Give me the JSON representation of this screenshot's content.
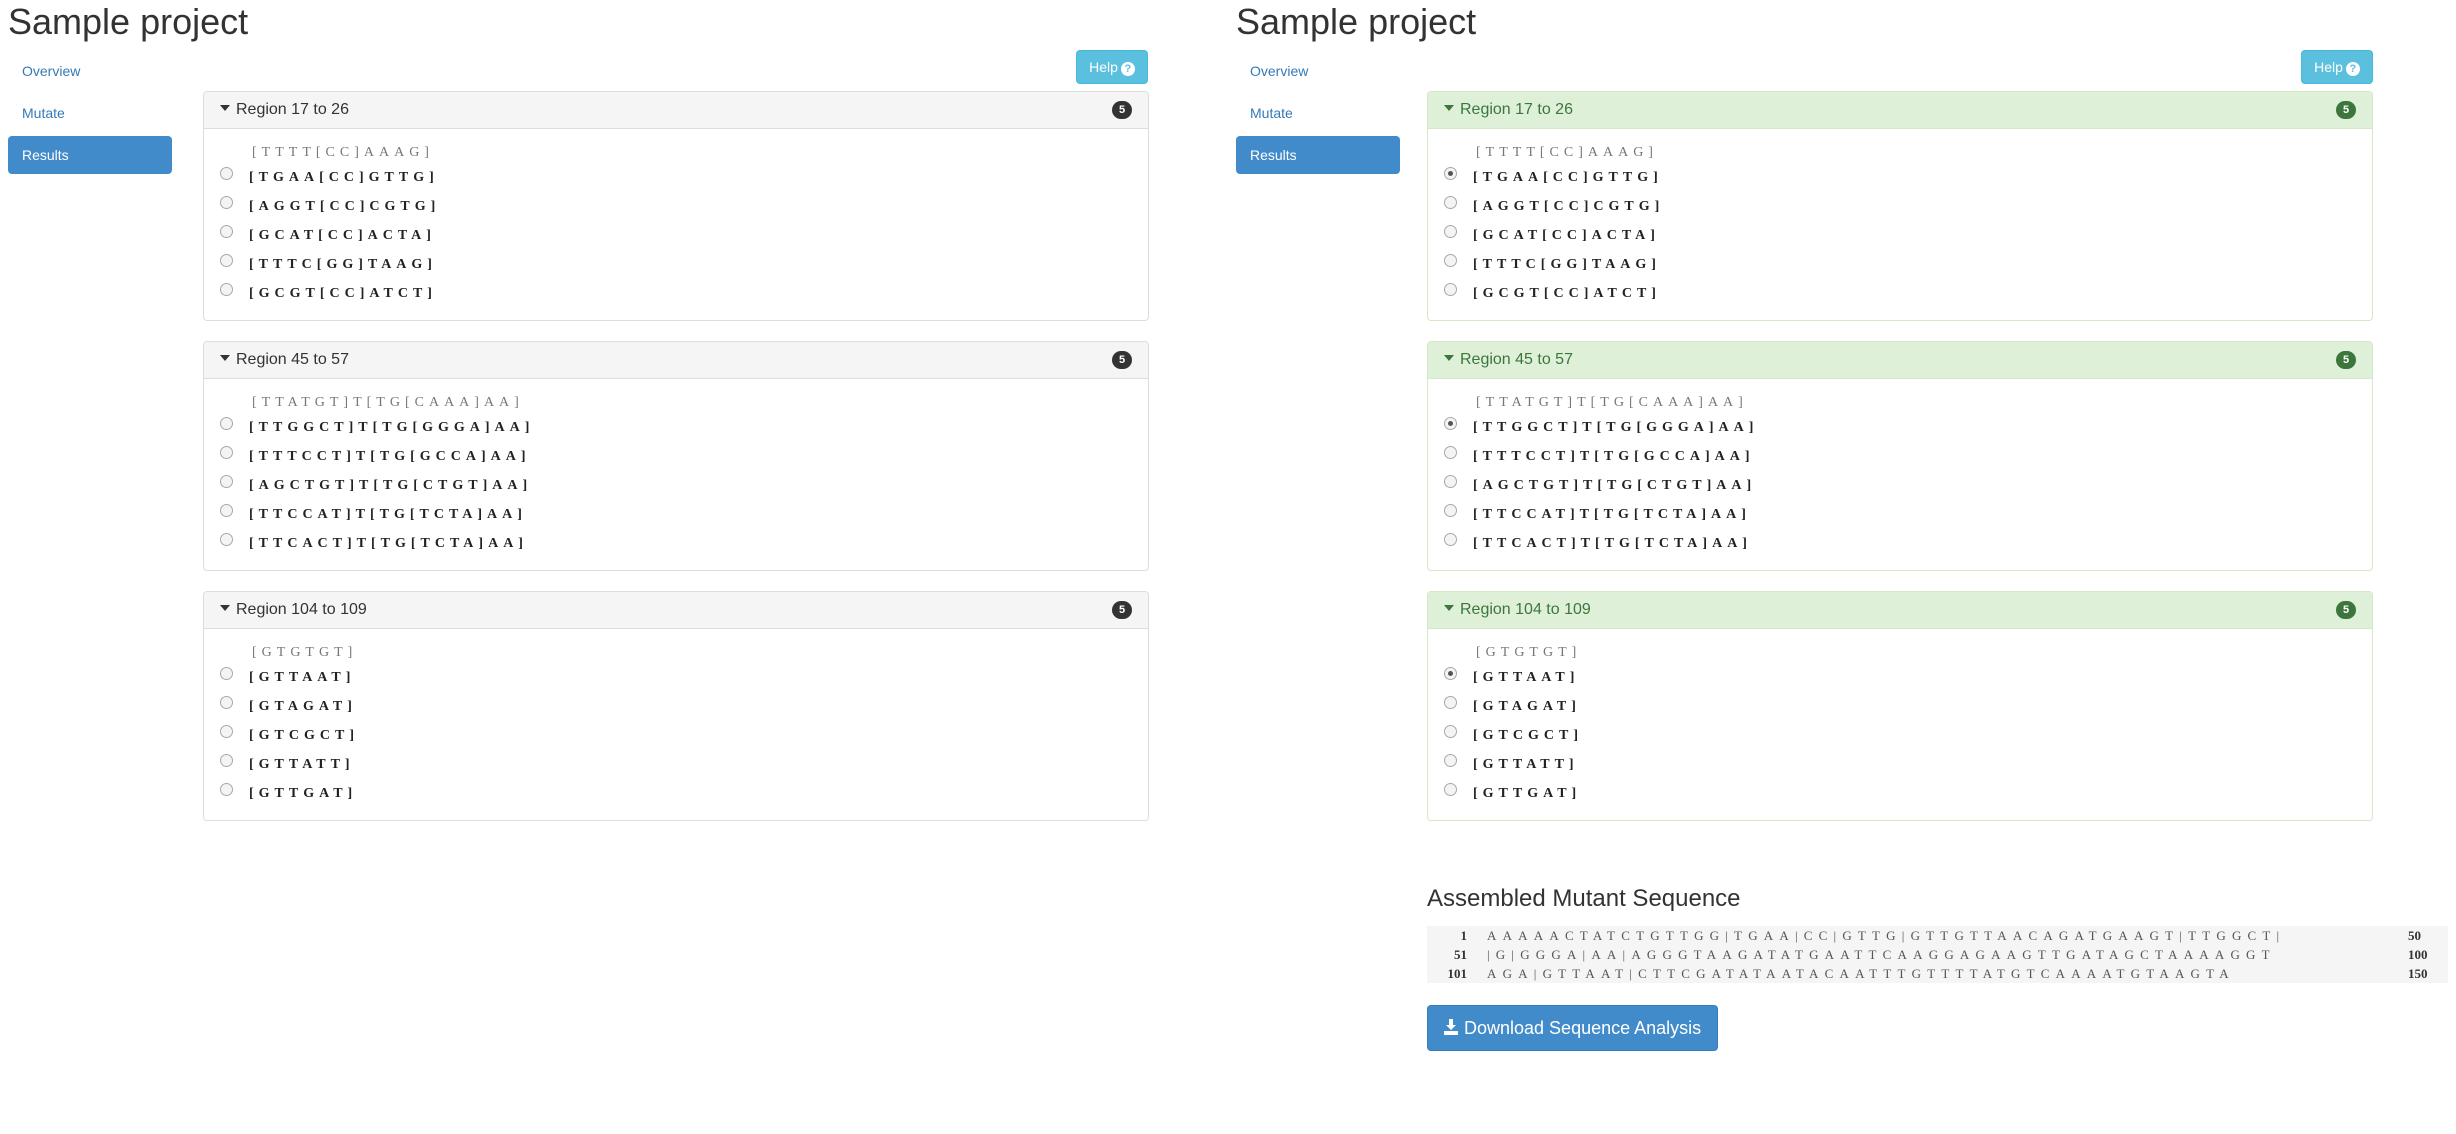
{
  "title": "Sample project",
  "nav": [
    "Overview",
    "Mutate",
    "Results"
  ],
  "help_label": "Help",
  "regions": [
    {
      "label": "Region 17 to 26",
      "count": "5",
      "original": "[TTTT[CC]AAAG]",
      "options": [
        "[TGAA[CC]GTTG]",
        "[AGGT[CC]CGTG]",
        "[GCAT[CC]ACTA]",
        "[TTTC[GG]TAAG]",
        "[GCGT[CC]ATCT]"
      ]
    },
    {
      "label": "Region 45 to 57",
      "count": "5",
      "original": "[TTATGT]T[TG[CAAA]AA]",
      "options": [
        "[TTGGCT]T[TG[GGGA]AA]",
        "[TTTCCT]T[TG[GCCA]AA]",
        "[AGCTGT]T[TG[CTGT]AA]",
        "[TTCCAT]T[TG[TCTA]AA]",
        "[TTCACT]T[TG[TCTA]AA]"
      ]
    },
    {
      "label": "Region 104 to 109",
      "count": "5",
      "original": "[GTGTGT]",
      "options": [
        "[GTTAAT]",
        "[GTAGAT]",
        "[GTCGCT]",
        "[GTTATT]",
        "[GTTGAT]"
      ]
    }
  ],
  "assembled": {
    "heading": "Assembled Mutant Sequence",
    "lines": [
      {
        "start": "1",
        "bases": "AAAAACTATCTGTTGG|TGAA|CC|GTTG|GTTGTTAACAGATGAAGT|TTGGCT|",
        "end": "50"
      },
      {
        "start": "51",
        "bases": "|G|GGGA|AA|AGGGTAAGATATGAATTCAAGGAGAAGTTGATAGCTAAAAGGT",
        "end": "100"
      },
      {
        "start": "101",
        "bases": "AGA|GTTAAT|CTTCGATATAATACAATTTGTTTTATGTCAAAATGTAAGTA",
        "end": "150"
      }
    ],
    "download_label": "Download Sequence Analysis"
  },
  "colors": {
    "primary": "#428bca",
    "info": "#5bc0de",
    "success_bg": "#dff0d8",
    "success_text": "#3c763d"
  }
}
